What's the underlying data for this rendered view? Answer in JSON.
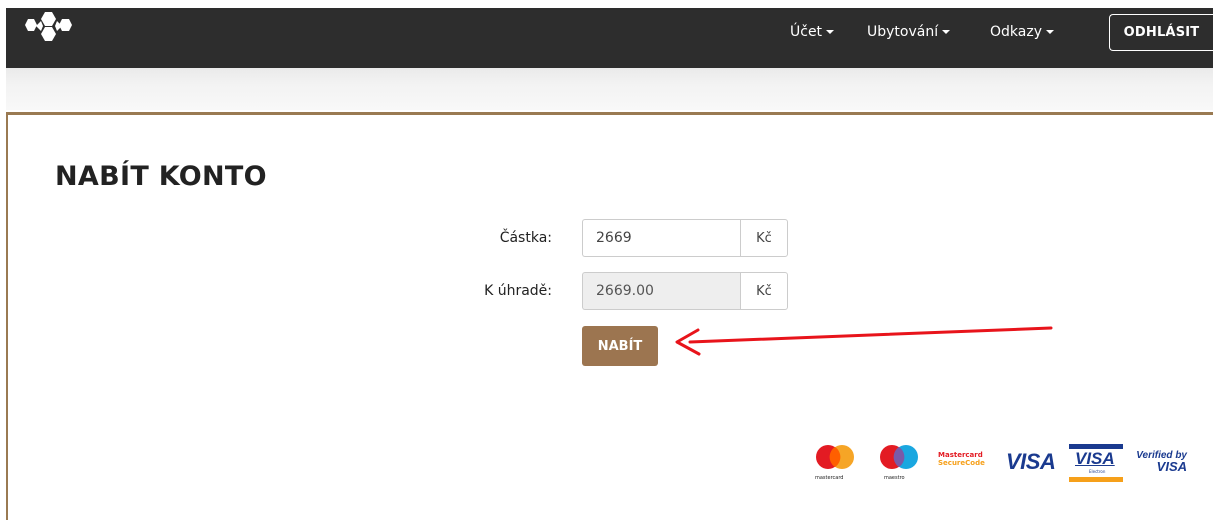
{
  "header": {
    "nav": [
      {
        "label": "Účet"
      },
      {
        "label": "Ubytování"
      },
      {
        "label": "Odkazy"
      }
    ],
    "logout_label": "ODHLÁSIT"
  },
  "page": {
    "title": "NABÍT KONTO"
  },
  "form": {
    "amount_label": "Částka:",
    "amount_value": "2669",
    "amount_unit": "Kč",
    "to_pay_label": "K úhradě:",
    "to_pay_value": "2669.00",
    "to_pay_unit": "Kč",
    "submit_label": "NABÍT"
  },
  "payment_logos": {
    "mastercard": "mastercard",
    "maestro": "maestro",
    "securecode_line1": "Mastercard",
    "securecode_line2": "SecureCode",
    "visa": "VISA",
    "visa_electron": "VISA",
    "visa_electron_sub": "Electron",
    "verified_by": "Verified by",
    "verified_visa": "VISA"
  },
  "colors": {
    "topbar": "#2d2d2d",
    "accent_brown": "#9c7550",
    "annotation_arrow": "#e8141b"
  },
  "icons": {
    "logo": "honeycomb-logo-icon",
    "nav_caret": "caret-down-icon",
    "annotation": "red-arrow-annotation"
  }
}
